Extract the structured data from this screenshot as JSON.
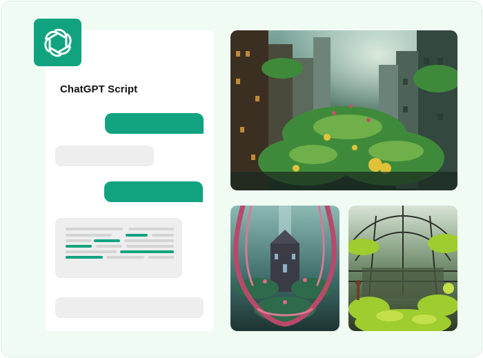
{
  "app": {
    "logo_icon": "openai-logo-icon",
    "title": "ChatGPT Script"
  },
  "colors": {
    "accent": "#11a37f",
    "background": "#f0fbf4",
    "bubble_gray": "#eeeeee"
  },
  "chat": {
    "messages": [
      {
        "role": "user"
      },
      {
        "role": "assistant"
      },
      {
        "role": "user"
      },
      {
        "role": "assistant"
      },
      {
        "role": "assistant"
      }
    ]
  },
  "gallery": {
    "images": [
      {
        "name": "overgrown-city-image"
      },
      {
        "name": "organic-portal-image"
      },
      {
        "name": "mossy-greenhouse-image"
      }
    ]
  }
}
